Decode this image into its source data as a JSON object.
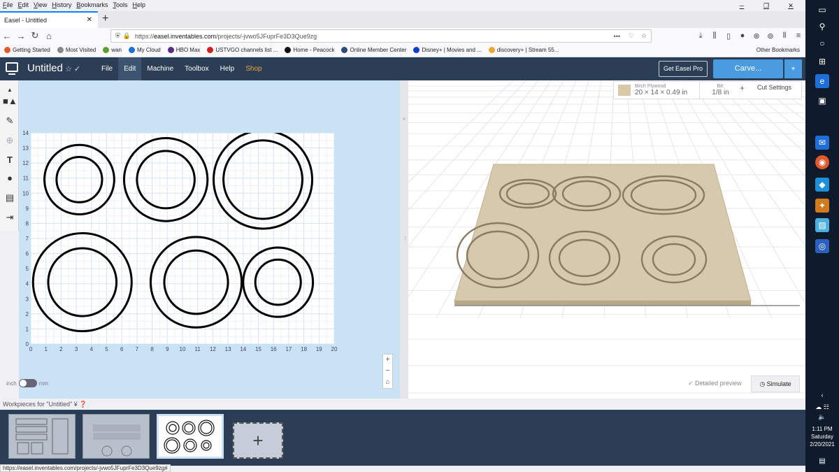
{
  "browser": {
    "menu": [
      "File",
      "Edit",
      "View",
      "History",
      "Bookmarks",
      "Tools",
      "Help"
    ],
    "tab_title": "Easel - Untitled",
    "url": "https://easel.inventables.com/projects/-jvwo5JFuprFe3D3Que9zg",
    "url_prefix": "https://",
    "url_domain": "easel.inventables.com",
    "url_path": "/projects/-jvwo5JFuprFe3D3Que9zg",
    "bookmarks": [
      {
        "label": "Getting Started",
        "color": "#e2592b"
      },
      {
        "label": "Most Visited",
        "color": "#888888"
      },
      {
        "label": "wan",
        "color": "#5aa02c"
      },
      {
        "label": "My Cloud",
        "color": "#1e6fd9"
      },
      {
        "label": "HBO Max",
        "color": "#5b2a86"
      },
      {
        "label": "USTVGO channels list ...",
        "color": "#d02020"
      },
      {
        "label": "Home - Peacock",
        "color": "#111111"
      },
      {
        "label": "Online Member Center",
        "color": "#2c4a7a"
      },
      {
        "label": "Disney+ | Movies and ...",
        "color": "#113ccf"
      },
      {
        "label": "discovery+ | Stream 55...",
        "color": "#e8a838"
      }
    ],
    "other_bookmarks": "Other Bookmarks",
    "status_url": "https://easel.inventables.com/projects/-jvwo5JFuprFe3D3Que9zg#"
  },
  "app": {
    "title": "Untitled",
    "menu": [
      "File",
      "Edit",
      "Machine",
      "Toolbox",
      "Help",
      "Shop"
    ],
    "get_pro": "Get Easel Pro",
    "carve": "Carve..."
  },
  "material": {
    "name": "Birch Plywood",
    "dims": "20 × 14 × 0.49 in",
    "bit_label": "Bit:",
    "bit_value": "1/8 in",
    "plus": "+",
    "cut_settings": "Cut Settings"
  },
  "canvas": {
    "y_ticks": [
      "0",
      "1",
      "2",
      "3",
      "4",
      "5",
      "6",
      "7",
      "8",
      "9",
      "10",
      "11",
      "12",
      "13",
      "14"
    ],
    "x_ticks": [
      "0",
      "1",
      "2",
      "3",
      "4",
      "5",
      "6",
      "7",
      "8",
      "9",
      "10",
      "11",
      "12",
      "13",
      "14",
      "15",
      "16",
      "17",
      "18",
      "19",
      "20"
    ],
    "unit_inch": "inch",
    "unit_mm": "mm",
    "zoom_in": "+",
    "zoom_out": "−",
    "home": "⌂"
  },
  "preview": {
    "detailed": "Detailed preview",
    "simulate": "Simulate"
  },
  "workpieces": {
    "label": "Workpieces for \"Untitled\""
  },
  "taskbar": {
    "time": "1:11 PM",
    "day": "Saturday",
    "date": "2/20/2021"
  }
}
